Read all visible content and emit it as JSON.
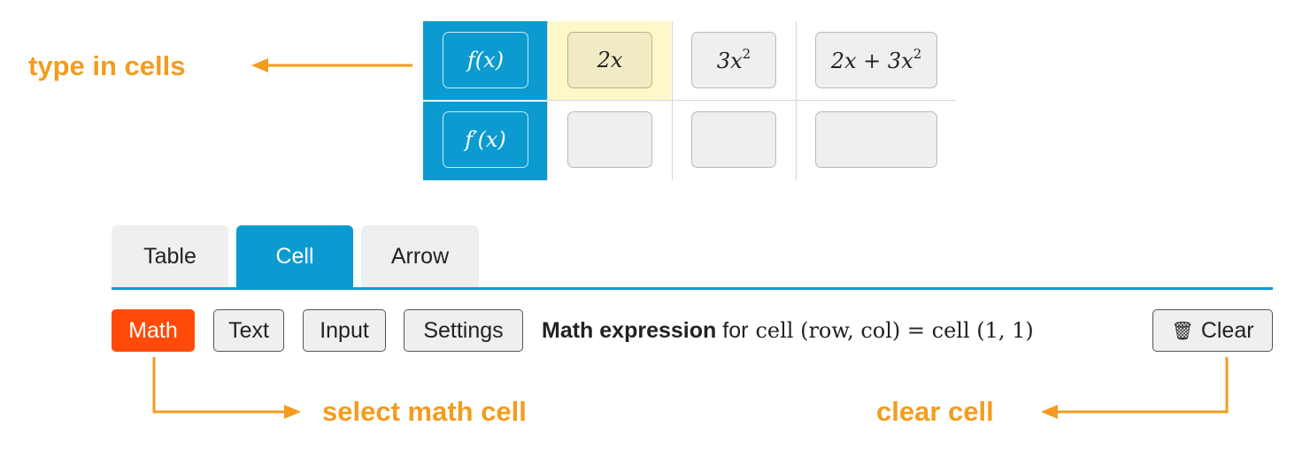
{
  "annotations": {
    "type_in_cells": "type in cells",
    "select_math_cell": "select math cell",
    "clear_cell": "clear cell",
    "arrow_color": "#f39c1f"
  },
  "table": {
    "row_headers": [
      "f(x)",
      "f′(x)"
    ],
    "rows": [
      [
        "2x",
        "3x2",
        "2x + 3x2"
      ],
      [
        "",
        "",
        ""
      ]
    ],
    "selected_cell": [
      1,
      1
    ],
    "header_color": "#0b9bd0",
    "highlight_color": "#fdf8c8"
  },
  "tabs": {
    "items": [
      "Table",
      "Cell",
      "Arrow"
    ],
    "active": "Cell",
    "accent": "#0b9bd0"
  },
  "toolbar": {
    "buttons": [
      "Math",
      "Text",
      "Input",
      "Settings"
    ],
    "active_button": "Math",
    "active_color": "#ff4a0a",
    "info_bold": "Math expression",
    "info_text": "for",
    "info_formula": "cell (row, col) = cell (1, 1)",
    "clear_label": "Clear",
    "clear_icon": "trash-icon"
  }
}
